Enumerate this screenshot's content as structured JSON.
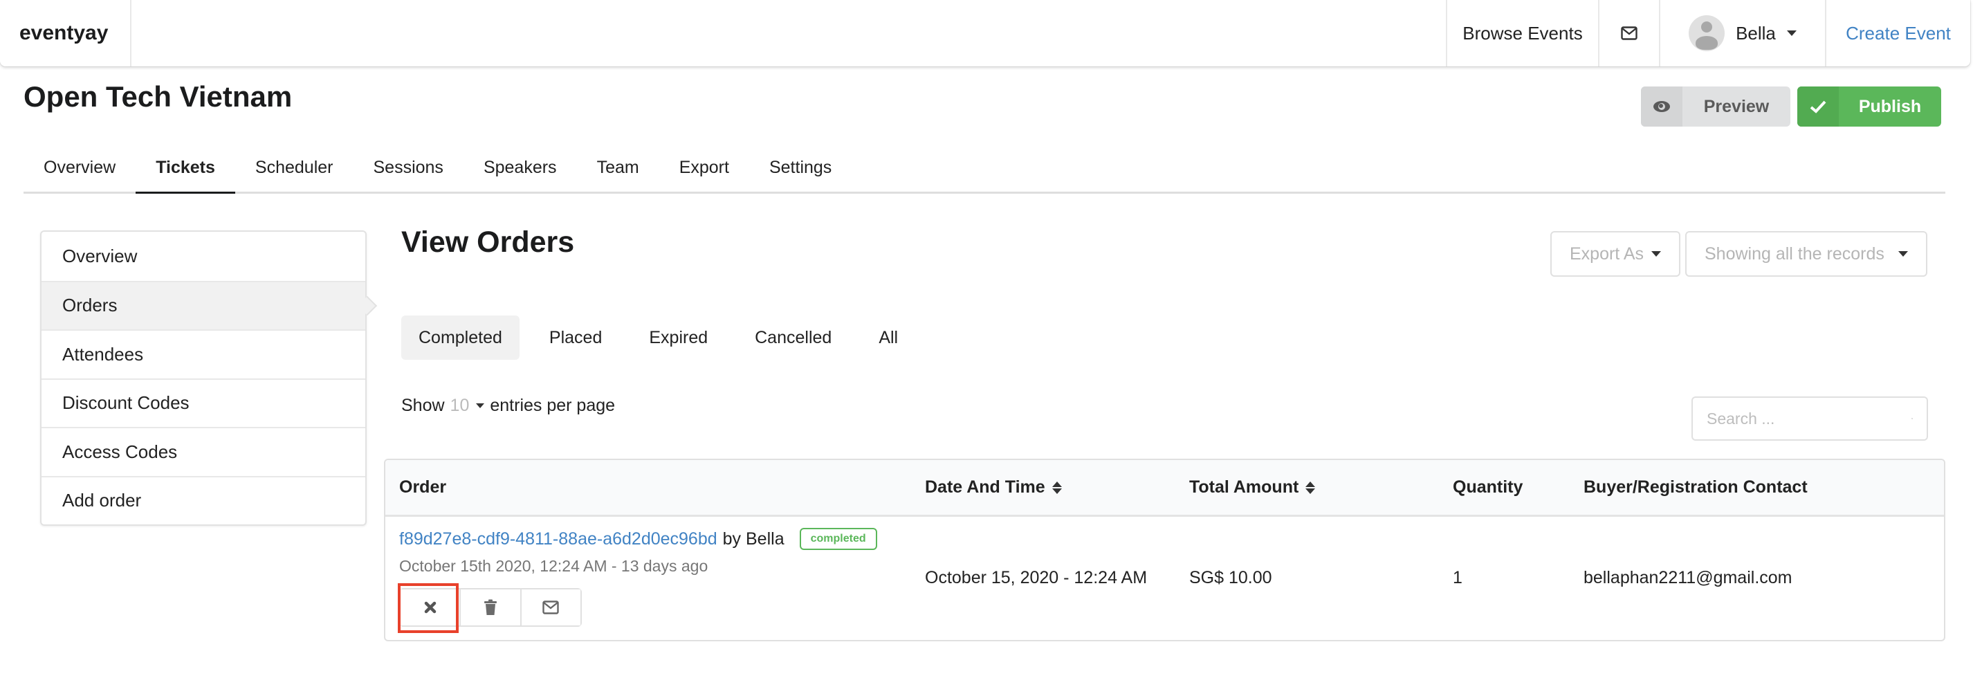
{
  "navbar": {
    "brand": "eventyay",
    "browse_events": "Browse Events",
    "mail_icon": "envelope-icon",
    "user_name": "Bella",
    "create_event": "Create Event"
  },
  "event": {
    "title": "Open Tech Vietnam",
    "preview_label": "Preview",
    "publish_label": "Publish",
    "tabs": [
      {
        "label": "Overview",
        "active": false
      },
      {
        "label": "Tickets",
        "active": true
      },
      {
        "label": "Scheduler",
        "active": false
      },
      {
        "label": "Sessions",
        "active": false
      },
      {
        "label": "Speakers",
        "active": false
      },
      {
        "label": "Team",
        "active": false
      },
      {
        "label": "Export",
        "active": false
      },
      {
        "label": "Settings",
        "active": false
      }
    ]
  },
  "sidebar": {
    "items": [
      {
        "label": "Overview",
        "active": false
      },
      {
        "label": "Orders",
        "active": true
      },
      {
        "label": "Attendees",
        "active": false
      },
      {
        "label": "Discount Codes",
        "active": false
      },
      {
        "label": "Access Codes",
        "active": false
      },
      {
        "label": "Add order",
        "active": false
      }
    ]
  },
  "main": {
    "heading": "View Orders",
    "export_as": "Export As",
    "records_filter": "Showing all the records",
    "status_tabs": [
      {
        "label": "Completed",
        "active": true
      },
      {
        "label": "Placed",
        "active": false
      },
      {
        "label": "Expired",
        "active": false
      },
      {
        "label": "Cancelled",
        "active": false
      },
      {
        "label": "All",
        "active": false
      }
    ],
    "entries": {
      "show": "Show",
      "per_page_value": "10",
      "suffix": "entries per page"
    },
    "search": {
      "placeholder": "Search ...",
      "value": ""
    }
  },
  "table": {
    "columns": [
      {
        "label": "Order",
        "sortable": false
      },
      {
        "label": "Date And Time",
        "sortable": true
      },
      {
        "label": "Total Amount",
        "sortable": true
      },
      {
        "label": "Quantity",
        "sortable": false
      },
      {
        "label": "Buyer/Registration Contact",
        "sortable": false
      }
    ],
    "rows": [
      {
        "order_id": "f89d27e8-cdf9-4811-88ae-a6d2d0ec96bd",
        "by": "by Bella",
        "status": "completed",
        "created": "October 15th 2020, 12:24 AM - 13 days ago",
        "date_time": "October 15, 2020 - 12:24 AM",
        "total_amount": "SG$ 10.00",
        "quantity": "1",
        "contact": "bellaphan2211@gmail.com",
        "actions": [
          "cancel-icon",
          "trash-icon",
          "envelope-icon"
        ]
      }
    ]
  },
  "colors": {
    "link": "#4183c4",
    "publish_green": "#5bb75a",
    "status_completed": "#5bb75a",
    "highlight_red": "#e8412b"
  }
}
